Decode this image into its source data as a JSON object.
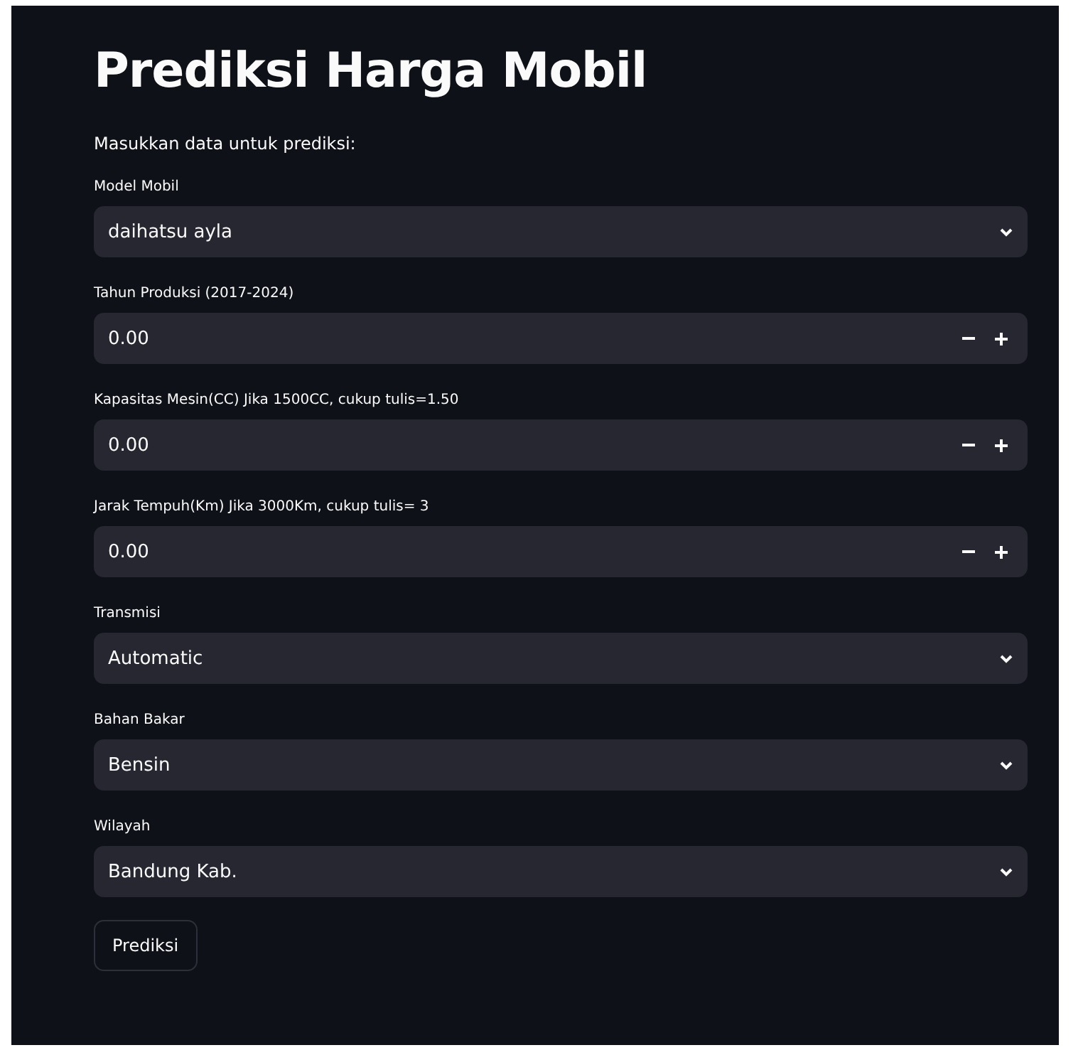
{
  "title": "Prediksi Harga Mobil",
  "subtitle": "Masukkan data untuk prediksi:",
  "fields": [
    {
      "kind": "select",
      "label": "Model Mobil",
      "value": "daihatsu ayla"
    },
    {
      "kind": "number",
      "label": "Tahun Produksi (2017-2024)",
      "value": "0.00"
    },
    {
      "kind": "number",
      "label": "Kapasitas Mesin(CC) Jika 1500CC, cukup tulis=1.50",
      "value": "0.00"
    },
    {
      "kind": "number",
      "label": "Jarak Tempuh(Km) Jika 3000Km, cukup tulis= 3",
      "value": "0.00"
    },
    {
      "kind": "select",
      "label": "Transmisi",
      "value": "Automatic"
    },
    {
      "kind": "select",
      "label": "Bahan Bakar",
      "value": "Bensin"
    },
    {
      "kind": "select",
      "label": "Wilayah",
      "value": "Bandung Kab."
    }
  ],
  "button": "Prediksi"
}
